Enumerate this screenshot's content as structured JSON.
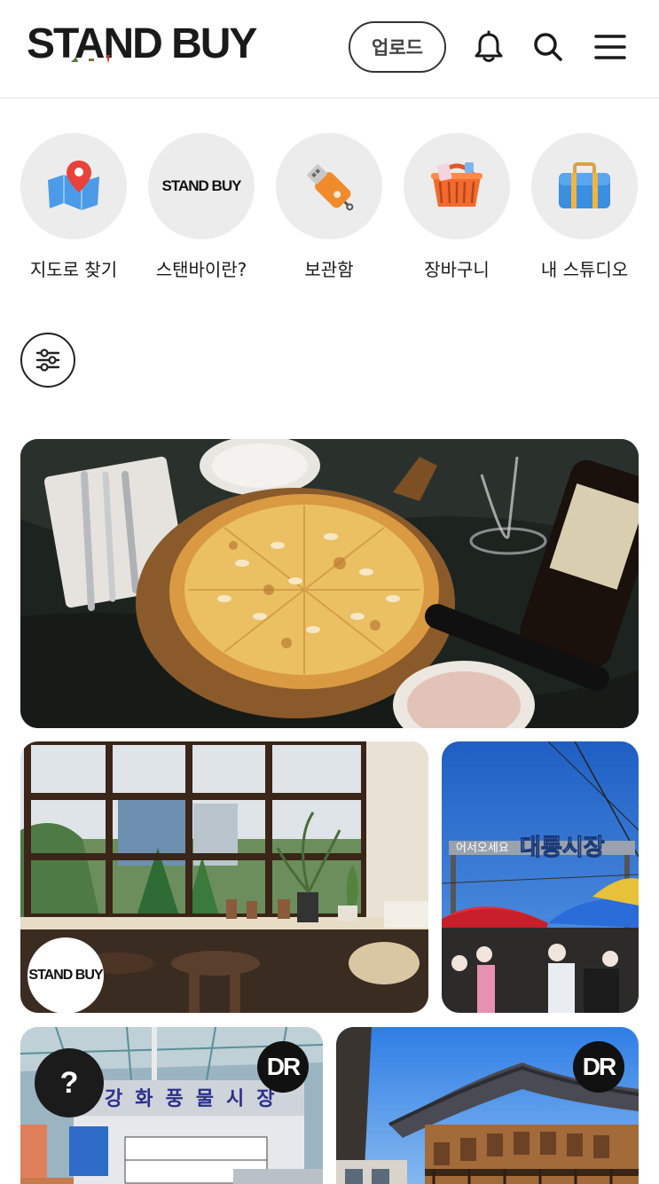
{
  "header": {
    "logo": "STAND BUY",
    "upload_label": "업로드",
    "icons": [
      "bell-icon",
      "search-icon",
      "menu-icon"
    ]
  },
  "categories": [
    {
      "label": "지도로 찾기",
      "icon": "map-pin-icon"
    },
    {
      "label": "스탠바이란?",
      "icon": "standbuy-logo",
      "logo_text": "STAND BUY"
    },
    {
      "label": "보관함",
      "icon": "usb-drive-icon"
    },
    {
      "label": "장바구니",
      "icon": "shopping-basket-icon"
    },
    {
      "label": "내 스튜디오",
      "icon": "briefcase-icon"
    }
  ],
  "filter": {
    "icon": "sliders-icon"
  },
  "feed": {
    "cards": [
      {
        "name": "pizza-photo",
        "badge": ""
      },
      {
        "name": "cafe-window-photo",
        "badge": "STAND BUY"
      },
      {
        "name": "market-sign-photo",
        "badge": "",
        "sign_text": "대룡시장",
        "sign_small": "어서오세요"
      },
      {
        "name": "market-building-photo",
        "badge": "DR",
        "sign_text": "강화풍물시장"
      },
      {
        "name": "hanok-building-photo",
        "badge": "DR"
      }
    ]
  },
  "help": {
    "label": "?"
  },
  "colors": {
    "accent": "#1b1b1b",
    "circle_bg": "#ececec"
  }
}
